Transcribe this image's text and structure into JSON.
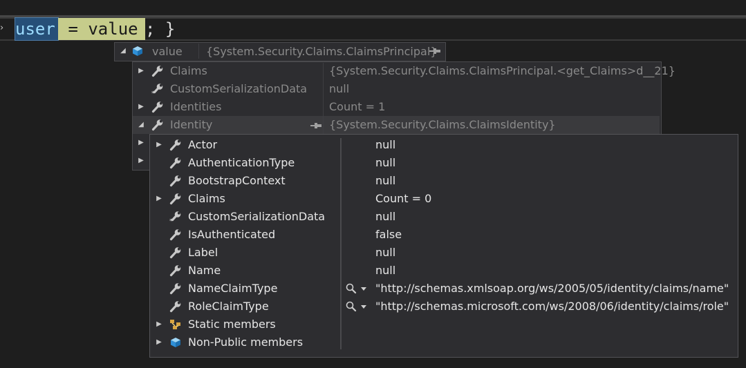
{
  "editor": {
    "arrow_glyph": "›",
    "code_user": "user",
    "code_assign": " = value",
    "code_rest": "; }"
  },
  "root": {
    "name": "value",
    "value": "{System.Security.Claims.ClaimsPrincipal}",
    "icon": "object-cube-icon"
  },
  "principal_members": [
    {
      "name": "Claims",
      "value": "{System.Security.Claims.ClaimsPrincipal.<get_Claims>d__21}",
      "expander": "collapsed",
      "icon": "wrench-icon"
    },
    {
      "name": "CustomSerializationData",
      "value": "null",
      "expander": "none",
      "icon": "wrench-star-icon"
    },
    {
      "name": "Identities",
      "value": "Count = 1",
      "expander": "collapsed",
      "icon": "wrench-icon"
    },
    {
      "name": "Identity",
      "value": "{System.Security.Claims.ClaimsIdentity}",
      "expander": "expanded",
      "icon": "wrench-icon"
    },
    {
      "name": "",
      "value": "",
      "expander": "collapsed",
      "icon": ""
    },
    {
      "name": "",
      "value": "",
      "expander": "collapsed",
      "icon": ""
    }
  ],
  "identity_members": [
    {
      "name": "Actor",
      "value": "null",
      "expander": "collapsed",
      "icon": "wrench-icon",
      "viz": false
    },
    {
      "name": "AuthenticationType",
      "value": "null",
      "expander": "none",
      "icon": "wrench-icon",
      "viz": false
    },
    {
      "name": "BootstrapContext",
      "value": "null",
      "expander": "none",
      "icon": "wrench-icon",
      "viz": false
    },
    {
      "name": "Claims",
      "value": "Count = 0",
      "expander": "collapsed",
      "icon": "wrench-icon",
      "viz": false
    },
    {
      "name": "CustomSerializationData",
      "value": "null",
      "expander": "none",
      "icon": "wrench-star-icon",
      "viz": false
    },
    {
      "name": "IsAuthenticated",
      "value": "false",
      "expander": "none",
      "icon": "wrench-icon",
      "viz": false
    },
    {
      "name": "Label",
      "value": "null",
      "expander": "none",
      "icon": "wrench-icon",
      "viz": false
    },
    {
      "name": "Name",
      "value": "null",
      "expander": "none",
      "icon": "wrench-icon",
      "viz": false
    },
    {
      "name": "NameClaimType",
      "value": "\"http://schemas.xmlsoap.org/ws/2005/05/identity/claims/name\"",
      "expander": "none",
      "icon": "wrench-icon",
      "viz": true
    },
    {
      "name": "RoleClaimType",
      "value": "\"http://schemas.microsoft.com/ws/2008/06/identity/claims/role\"",
      "expander": "none",
      "icon": "wrench-icon",
      "viz": true
    },
    {
      "name": "Static members",
      "value": "",
      "expander": "collapsed",
      "icon": "static-members-icon",
      "viz": false
    },
    {
      "name": "Non-Public members",
      "value": "",
      "expander": "collapsed",
      "icon": "object-cube-icon",
      "viz": false
    }
  ]
}
